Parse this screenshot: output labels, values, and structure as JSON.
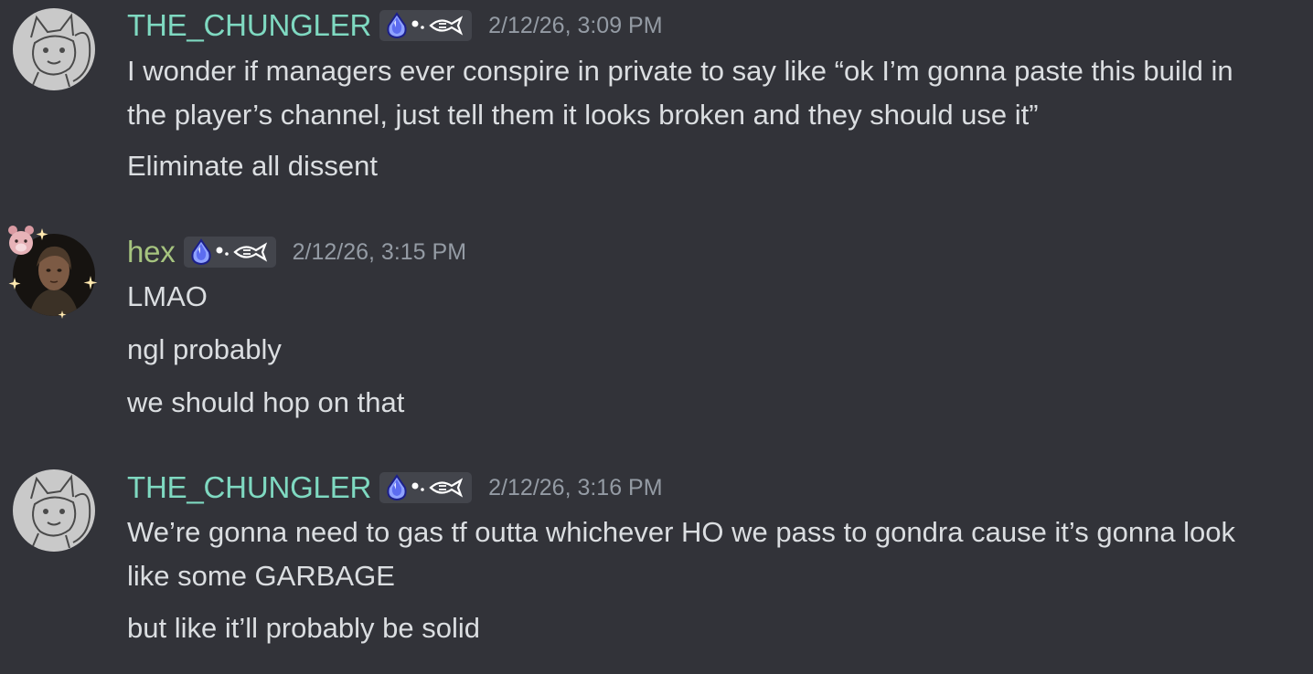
{
  "colors": {
    "background": "#323339",
    "text": "#dbdee1",
    "timestamp": "#949ba4",
    "username_chungler": "#7fd9c1",
    "username_hex": "#a6c47f",
    "tag_background": "#43454c"
  },
  "messages": [
    {
      "author": "THE_CHUNGLER",
      "avatar_icon": "sketch-creature-avatar",
      "tag_icons": [
        "blue-gem-icon",
        "fish-icon"
      ],
      "timestamp": "2/12/26, 3:09 PM",
      "lines": [
        "I wonder if managers ever conspire in private to say like “ok I’m gonna paste this build in the player’s channel, just tell them it looks broken and they should use it”",
        "Eliminate all dissent"
      ]
    },
    {
      "author": "hex",
      "avatar_icon": "portrait-avatar",
      "avatar_decoration": "teddy-bear-sparkles-decoration",
      "tag_icons": [
        "blue-gem-icon",
        "fish-icon"
      ],
      "timestamp": "2/12/26, 3:15 PM",
      "lines": [
        "LMAO",
        "ngl probably",
        "we should hop on that"
      ]
    },
    {
      "author": "THE_CHUNGLER",
      "avatar_icon": "sketch-creature-avatar",
      "tag_icons": [
        "blue-gem-icon",
        "fish-icon"
      ],
      "timestamp": "2/12/26, 3:16 PM",
      "lines": [
        "We’re gonna need to gas tf outta whichever HO we pass to gondra cause it’s gonna look like some GARBAGE",
        "but like it’ll probably be solid"
      ]
    }
  ]
}
